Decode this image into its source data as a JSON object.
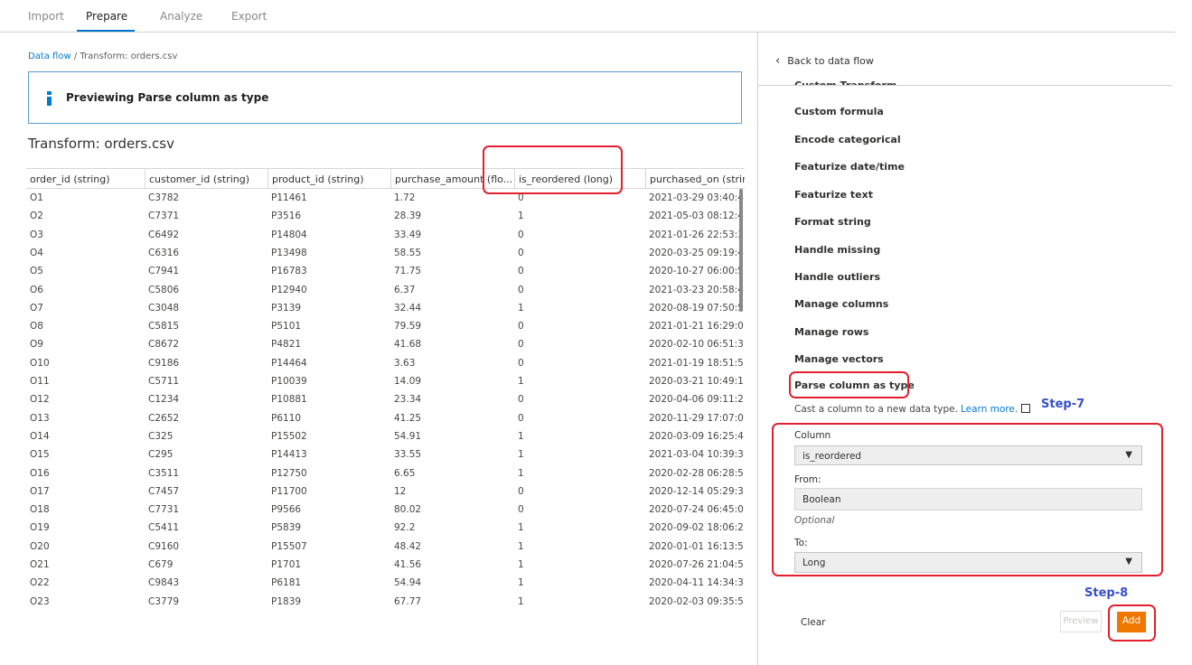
{
  "topnav": {
    "tabs": [
      "Import",
      "Prepare",
      "Analyze",
      "Export"
    ],
    "active": "Prepare"
  },
  "breadcrumb": {
    "link": "Data flow",
    "separator": " / ",
    "current": "Transform: orders.csv"
  },
  "info_banner": "Previewing Parse column as type",
  "page_title": "Transform: orders.csv",
  "table": {
    "columns": [
      "order_id (string)",
      "customer_id (string)",
      "product_id (string)",
      "purchase_amount (flo...",
      "is_reordered (long)",
      "purchased_on (strin"
    ],
    "rows": [
      [
        "O1",
        "C3782",
        "P11461",
        "1.72",
        "0",
        "2021-03-29 03:40:4"
      ],
      [
        "O2",
        "C7371",
        "P3516",
        "28.39",
        "1",
        "2021-05-03 08:12:4"
      ],
      [
        "O3",
        "C6492",
        "P14804",
        "33.49",
        "0",
        "2021-01-26 22:53:3"
      ],
      [
        "O4",
        "C6316",
        "P13498",
        "58.55",
        "0",
        "2020-03-25 09:19:4"
      ],
      [
        "O5",
        "C7941",
        "P16783",
        "71.75",
        "0",
        "2020-10-27 06:00:5"
      ],
      [
        "O6",
        "C5806",
        "P12940",
        "6.37",
        "0",
        "2021-03-23 20:58:4"
      ],
      [
        "O7",
        "C3048",
        "P3139",
        "32.44",
        "1",
        "2020-08-19 07:50:5"
      ],
      [
        "O8",
        "C5815",
        "P5101",
        "79.59",
        "0",
        "2021-01-21 16:29:0"
      ],
      [
        "O9",
        "C8672",
        "P4821",
        "41.68",
        "0",
        "2020-02-10 06:51:3"
      ],
      [
        "O10",
        "C9186",
        "P14464",
        "3.63",
        "0",
        "2021-01-19 18:51:5"
      ],
      [
        "O11",
        "C5711",
        "P10039",
        "14.09",
        "1",
        "2020-03-21 10:49:1"
      ],
      [
        "O12",
        "C1234",
        "P10881",
        "23.34",
        "0",
        "2020-04-06 09:11:2"
      ],
      [
        "O13",
        "C2652",
        "P6110",
        "41.25",
        "0",
        "2020-11-29 17:07:0"
      ],
      [
        "O14",
        "C325",
        "P15502",
        "54.91",
        "1",
        "2020-03-09 16:25:4"
      ],
      [
        "O15",
        "C295",
        "P14413",
        "33.55",
        "1",
        "2021-03-04 10:39:3"
      ],
      [
        "O16",
        "C3511",
        "P12750",
        "6.65",
        "1",
        "2020-02-28 06:28:5"
      ],
      [
        "O17",
        "C7457",
        "P11700",
        "12",
        "0",
        "2020-12-14 05:29:3"
      ],
      [
        "O18",
        "C7731",
        "P9566",
        "80.02",
        "0",
        "2020-07-24 06:45:0"
      ],
      [
        "O19",
        "C5411",
        "P5839",
        "92.2",
        "1",
        "2020-09-02 18:06:2"
      ],
      [
        "O20",
        "C9160",
        "P15507",
        "48.42",
        "1",
        "2020-01-01 16:13:5"
      ],
      [
        "O21",
        "C679",
        "P1701",
        "41.56",
        "1",
        "2020-07-26 21:04:5"
      ],
      [
        "O22",
        "C9843",
        "P6181",
        "54.94",
        "1",
        "2020-04-11 14:34:3"
      ],
      [
        "O23",
        "C3779",
        "P1839",
        "67.77",
        "1",
        "2020-02-03 09:35:5"
      ]
    ]
  },
  "right_panel": {
    "back_label": "Back to data flow",
    "cutoff_item": "Custom Transform",
    "transforms": [
      "Custom formula",
      "Encode categorical",
      "Featurize date/time",
      "Featurize text",
      "Format string",
      "Handle missing",
      "Handle outliers",
      "Manage columns",
      "Manage rows",
      "Manage vectors",
      "Parse column as type"
    ],
    "description": "Cast a column to a new data type.",
    "learn_more": "Learn more.",
    "step7": "Step-7",
    "step8": "Step-8",
    "form": {
      "column_label": "Column",
      "column_value": "is_reordered",
      "from_label": "From:",
      "from_value": "Boolean",
      "optional_label": "Optional",
      "to_label": "To:",
      "to_value": "Long"
    },
    "buttons": {
      "clear": "Clear",
      "preview": "Preview",
      "add": "Add"
    }
  },
  "colors": {
    "accent": "#0078d4",
    "add_button": "#f07800",
    "highlight": "#e3202e",
    "step_text": "#3550c8"
  }
}
